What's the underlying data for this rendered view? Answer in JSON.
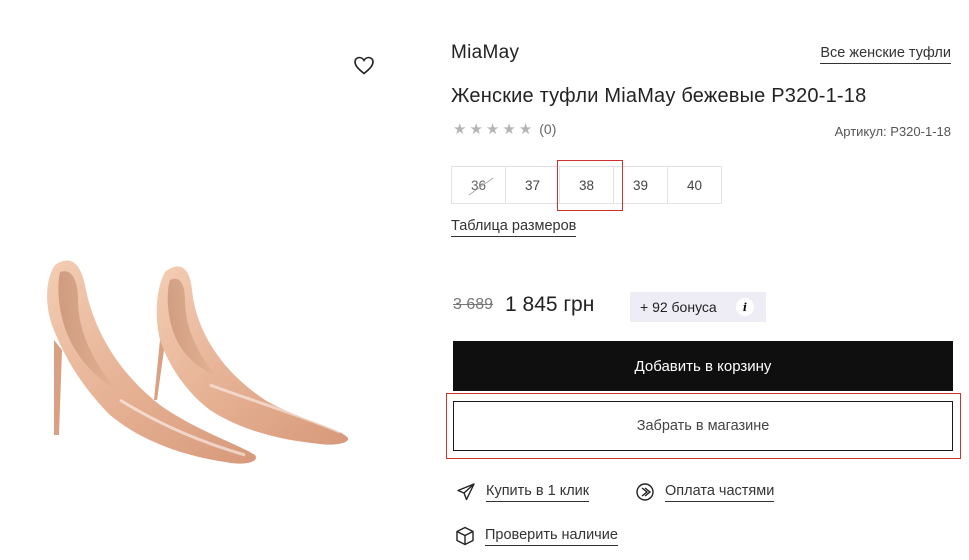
{
  "product": {
    "brand": "MiaMay",
    "title": "Женские туфли MiaMay бежевые P320-1-18",
    "all_link": "Все женские туфли",
    "rating_count": "(0)",
    "stars": 5,
    "sku": "Артикул: P320-1-18"
  },
  "sizes": [
    {
      "label": "36",
      "available": false
    },
    {
      "label": "37",
      "available": true
    },
    {
      "label": "38",
      "available": true,
      "selected": true
    },
    {
      "label": "39",
      "available": true
    },
    {
      "label": "40",
      "available": true
    }
  ],
  "size_table_link": "Таблица размеров",
  "pricing": {
    "old_price": "3 689",
    "price": "1 845 грн",
    "bonus": "+ 92 бонуса",
    "info_icon": "i"
  },
  "buttons": {
    "add_to_cart": "Добавить в корзину",
    "pickup": "Забрать в магазине"
  },
  "actions": {
    "buy_one_click": "Купить в 1 клик",
    "installments": "Оплата частями",
    "check_availability": "Проверить наличие"
  },
  "icons": {
    "wishlist": "heart-icon",
    "buy_one_click": "paper-plane-icon",
    "installments": "installments-icon",
    "check_availability": "box-icon"
  },
  "colors": {
    "accent_highlight": "#d43030",
    "cart_button": "#0f0f0f",
    "bonus_bg": "#eeedf6",
    "shoe": "#e8b89a"
  }
}
